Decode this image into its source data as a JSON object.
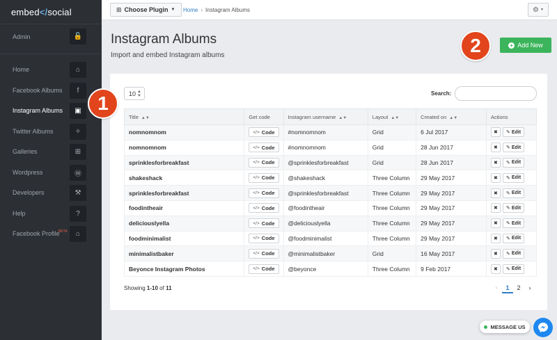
{
  "logo": {
    "text_a": "embed",
    "text_b": "social"
  },
  "sidebar": {
    "items": [
      {
        "label": "Admin",
        "icon": "unlock-icon",
        "glyph": "🔓",
        "active": false
      },
      {
        "label": "Home",
        "icon": "home-icon",
        "glyph": "⌂",
        "active": false
      },
      {
        "label": "Facebook Albums",
        "icon": "facebook-icon",
        "glyph": "f",
        "active": false
      },
      {
        "label": "Instagram Albums",
        "icon": "instagram-icon",
        "glyph": "▣",
        "active": true
      },
      {
        "label": "Twitter Albums",
        "icon": "twitter-icon",
        "glyph": "✧",
        "active": false
      },
      {
        "label": "Galleries",
        "icon": "grid-icon",
        "glyph": "⊞",
        "active": false
      },
      {
        "label": "Wordpress",
        "icon": "wordpress-icon",
        "glyph": "Ⓦ",
        "active": false
      },
      {
        "label": "Developers",
        "icon": "wrench-icon",
        "glyph": "⚒",
        "active": false
      },
      {
        "label": "Help",
        "icon": "help-icon",
        "glyph": "?",
        "active": false
      },
      {
        "label": "Facebook Profile",
        "badge": "BETA",
        "icon": "user-icon",
        "glyph": "⌂",
        "active": false
      }
    ]
  },
  "topbar": {
    "choose_plugin": "Choose Plugin",
    "breadcrumb_home": "Home",
    "breadcrumb_current": "Instagram Albums"
  },
  "header": {
    "title": "Instagram Albums",
    "subtitle": "Import and embed Instagram albums",
    "add_new": "Add New"
  },
  "steps": {
    "one": "1",
    "two": "2"
  },
  "table": {
    "page_size": "10",
    "search_label": "Search:",
    "columns": [
      "Title",
      "Get code",
      "Instagram username",
      "Layout",
      "Created on",
      "Actions"
    ],
    "code_label": "Code",
    "edit_label": "Edit",
    "delete_label": "✖",
    "rows": [
      {
        "title": "nomnomnom",
        "username": "#nomnomnom",
        "layout": "Grid",
        "created": "6 Jul 2017"
      },
      {
        "title": "nomnomnom",
        "username": "#nomnomnom",
        "layout": "Grid",
        "created": "28 Jun 2017"
      },
      {
        "title": "sprinklesforbreakfast",
        "username": "@sprinklesforbreakfast",
        "layout": "Grid",
        "created": "28 Jun 2017"
      },
      {
        "title": "shakeshack",
        "username": "@shakeshack",
        "layout": "Three Column",
        "created": "29 May 2017"
      },
      {
        "title": "sprinklesforbreakfast",
        "username": "@sprinklesforbreakfast",
        "layout": "Three Column",
        "created": "29 May 2017"
      },
      {
        "title": "foodintheair",
        "username": "@foodintheair",
        "layout": "Three Column",
        "created": "29 May 2017"
      },
      {
        "title": "deliciouslyella",
        "username": "@deliciouslyella",
        "layout": "Three Column",
        "created": "29 May 2017"
      },
      {
        "title": "foodminimalist",
        "username": "@foodminimalist",
        "layout": "Three Column",
        "created": "29 May 2017"
      },
      {
        "title": "minimalistbaker",
        "username": "@minimalistbaker",
        "layout": "Grid",
        "created": "16 May 2017"
      },
      {
        "title": "Beyonce Instagram Photos",
        "username": "@beyonce",
        "layout": "Three Column",
        "created": "9 Feb 2017"
      }
    ],
    "showing_prefix": "Showing ",
    "showing_range": "1-10",
    "showing_of": " of ",
    "showing_total": "11",
    "pages": [
      "1",
      "2"
    ],
    "current_page": "1"
  },
  "messenger": {
    "label": "MESSAGE US"
  },
  "colors": {
    "sidebar": "#2c3035",
    "accent": "#2c7ec4",
    "add_new": "#3bb45c",
    "step_badge": "#e2451c"
  }
}
